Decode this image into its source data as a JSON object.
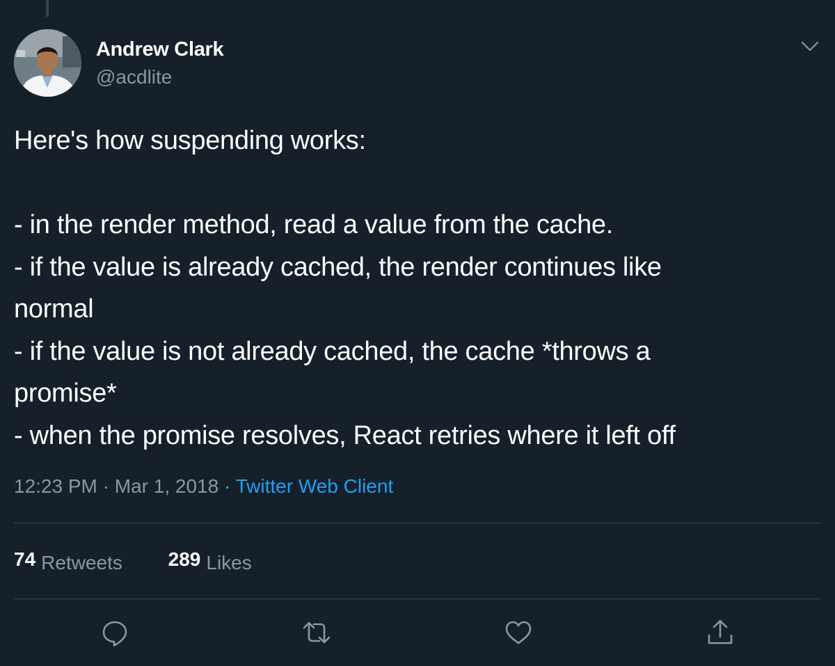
{
  "tweet": {
    "author": {
      "name": "Andrew Clark",
      "handle": "@acdlite"
    },
    "text_lines": [
      "Here's how suspending works:",
      "",
      "- in the render method, read a value from the cache.",
      "- if the value is already cached, the render continues like",
      "normal",
      "- if the value is not already cached, the cache *throws a",
      "promise*",
      "- when the promise resolves, React retries where it left off"
    ],
    "meta": {
      "time": "12:23 PM",
      "separator": " · ",
      "date": "Mar 1, 2018",
      "source": "Twitter Web Client"
    },
    "stats": {
      "retweets_count": "74",
      "retweets_label": "Retweets",
      "likes_count": "289",
      "likes_label": "Likes"
    },
    "actions": {
      "reply_icon": "reply-icon",
      "retweet_icon": "retweet-icon",
      "like_icon": "heart-icon",
      "share_icon": "share-icon",
      "menu_icon": "chevron-down-icon"
    }
  },
  "colors": {
    "background": "#15202b",
    "primary_text": "#ffffff",
    "secondary_text": "#8899a6",
    "link": "#1da1f2",
    "divider": "#38444d"
  }
}
